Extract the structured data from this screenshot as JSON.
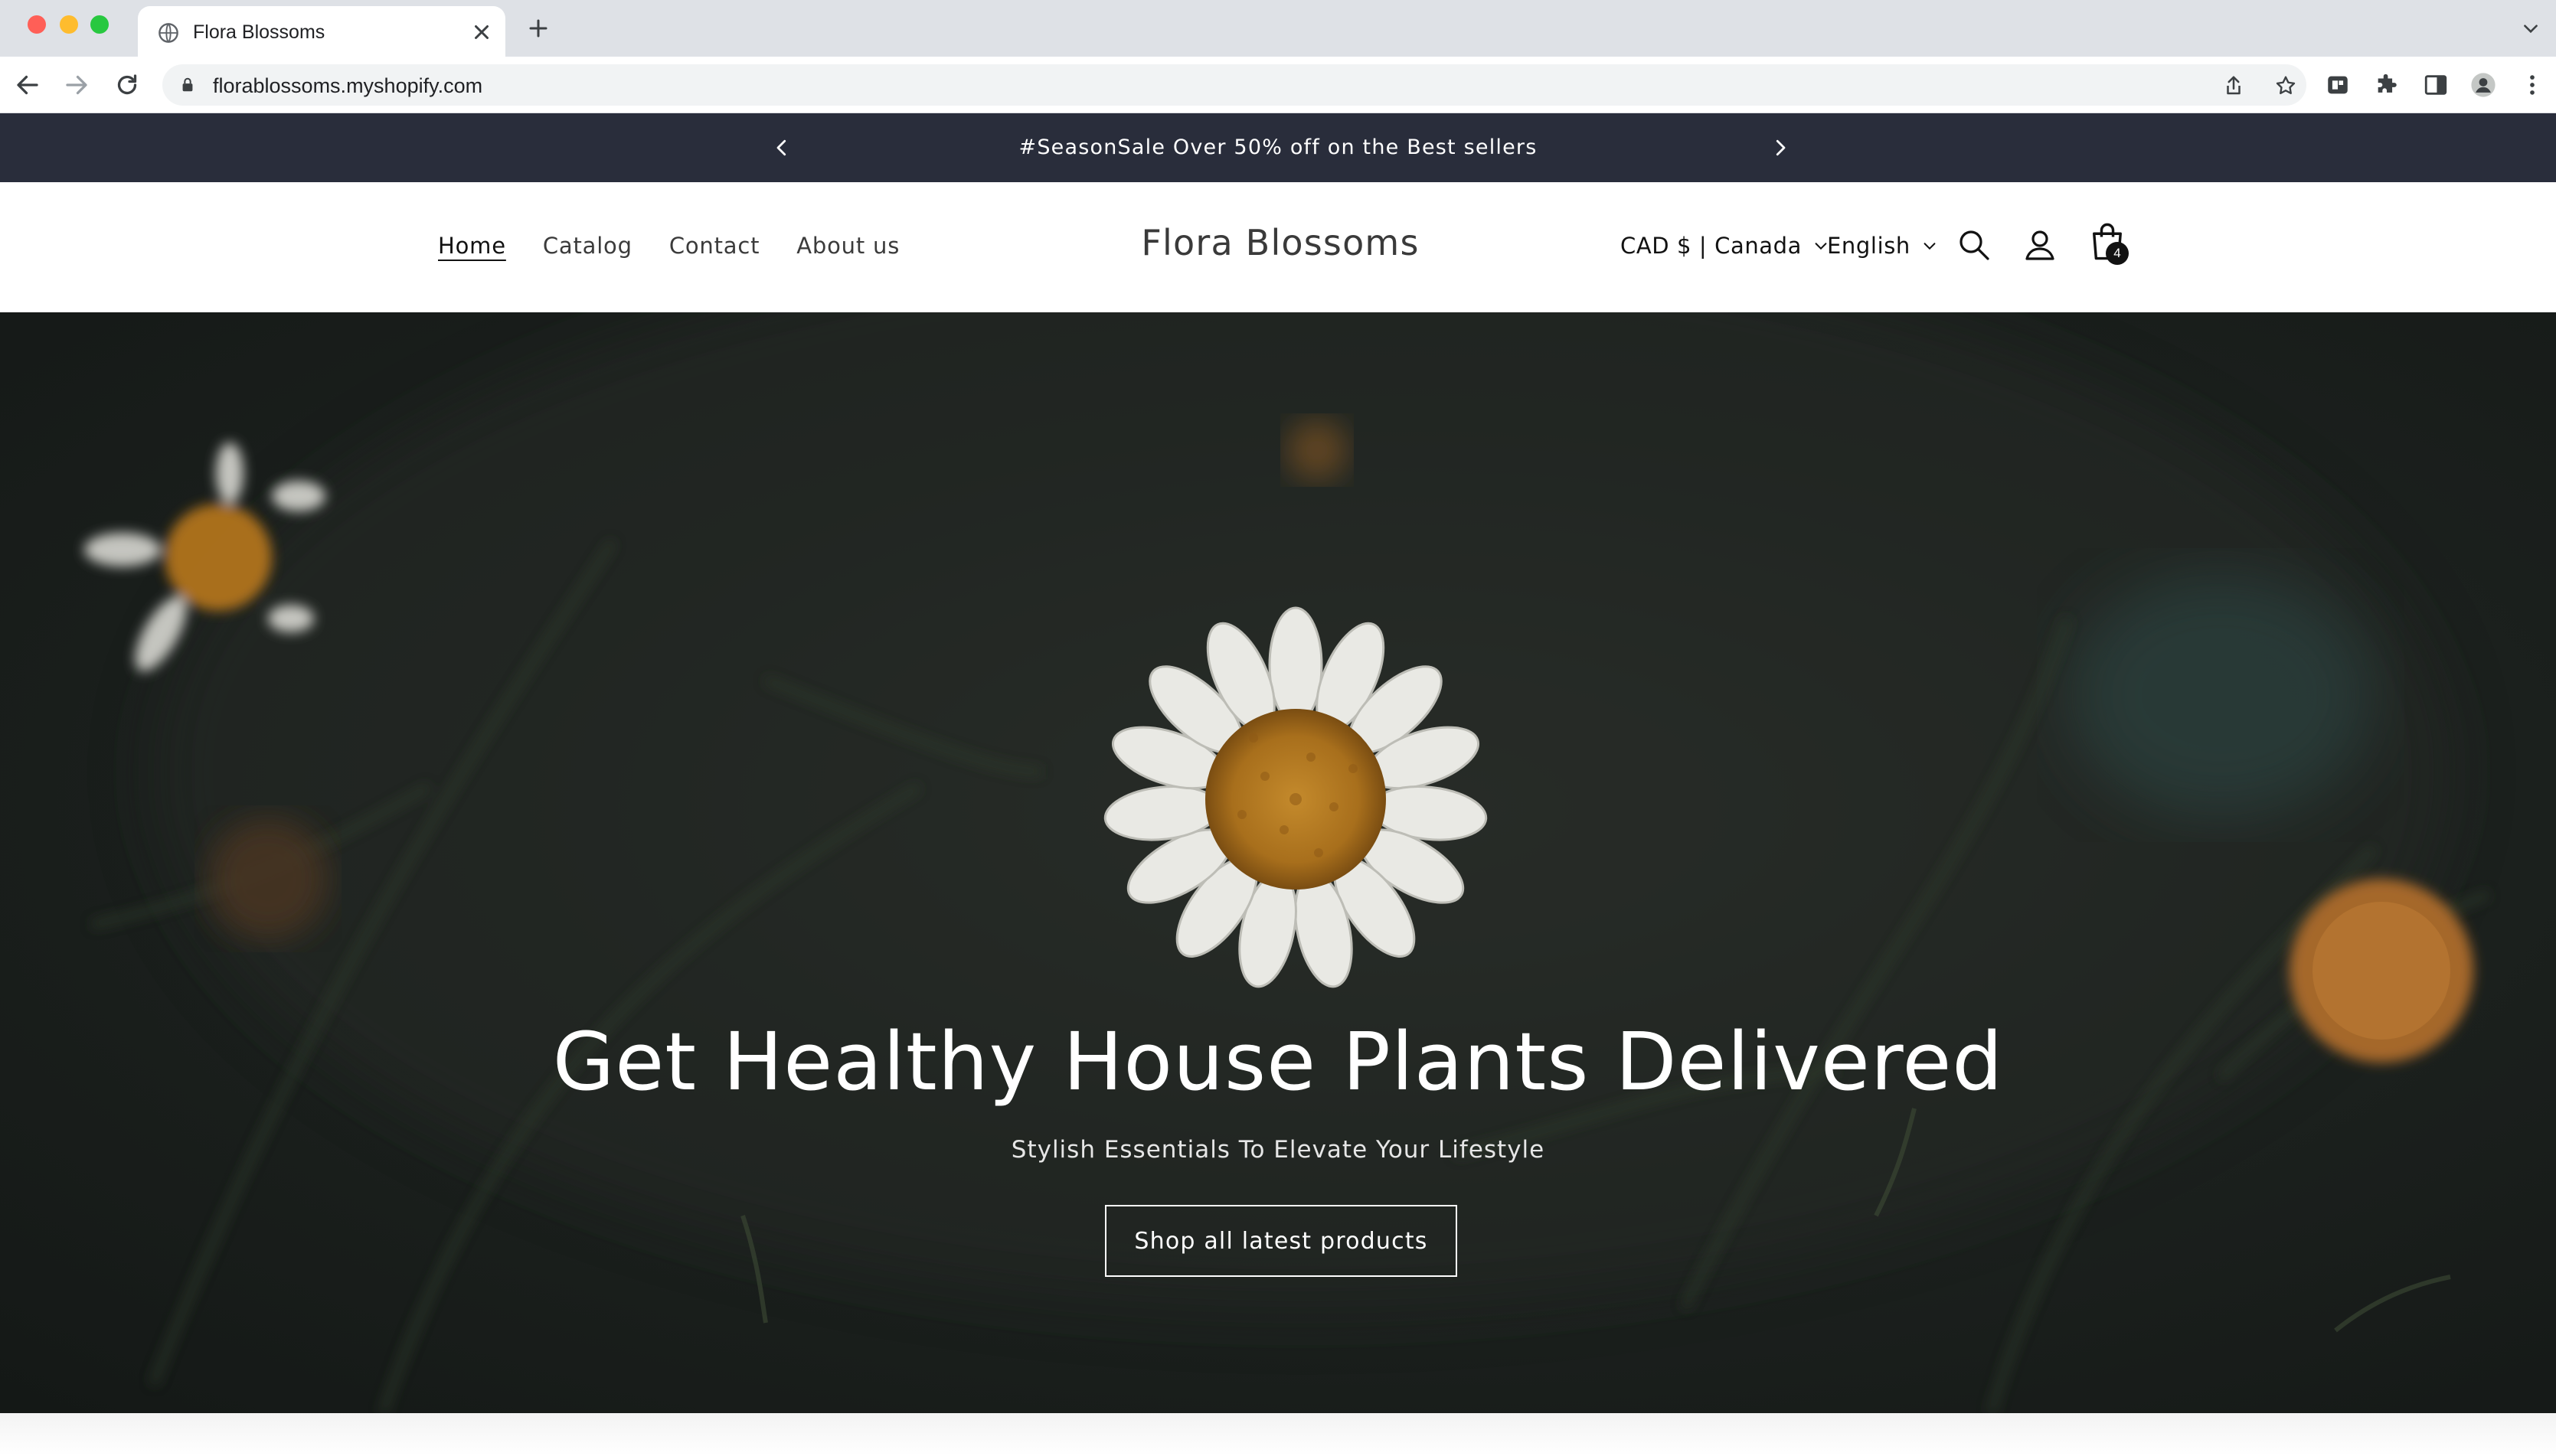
{
  "browser": {
    "tab_title": "Flora Blossoms",
    "url": "florablossoms.myshopify.com"
  },
  "announcement": {
    "text": "#SeasonSale Over 50% off on the Best sellers"
  },
  "header": {
    "nav": [
      "Home",
      "Catalog",
      "Contact",
      "About us"
    ],
    "active_nav": "Home",
    "logo": "Flora Blossoms",
    "country_selector": "CAD $ | Canada",
    "language_selector": "English",
    "cart_count": "4"
  },
  "hero": {
    "title": "Get Healthy House Plants Delivered",
    "subtitle": "Stylish Essentials To Elevate Your Lifestyle",
    "button_label": "Shop all latest products"
  },
  "colors": {
    "announcement_bg": "#292d3b",
    "hero_bg": "#1d221f",
    "text_dark": "#121212"
  },
  "icons": [
    "globe-icon",
    "close-icon",
    "plus-icon",
    "back-arrow-icon",
    "forward-arrow-icon",
    "reload-icon",
    "lock-icon",
    "share-icon",
    "star-icon",
    "extension-icon",
    "puzzle-icon",
    "side-panel-icon",
    "profile-icon",
    "kebab-menu-icon",
    "chevron-left-icon",
    "chevron-right-icon",
    "chevron-down-icon",
    "search-icon",
    "account-icon",
    "cart-icon"
  ]
}
